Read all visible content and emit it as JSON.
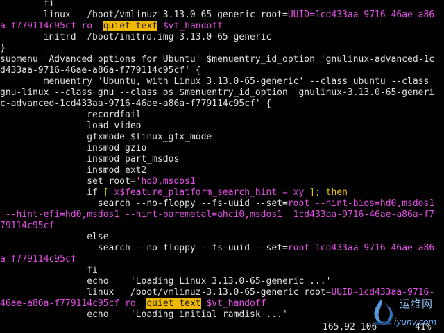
{
  "terminal": {
    "lines": [
      [
        [
          "t",
          "        fi"
        ]
      ],
      [
        [
          "t",
          "        linux   /boot/vmlinuz-3.13.0-65-generic root="
        ],
        [
          "p",
          "UUID=1cd433aa-9716-46ae-a86"
        ]
      ],
      [
        [
          "p",
          "a-f779114c95cf ro  "
        ],
        [
          "h",
          "quiet text"
        ],
        [
          "t",
          " "
        ],
        [
          "p",
          "$vt_handoff"
        ]
      ],
      [
        [
          "t",
          "        initrd  /boot/initrd.img-3.13.0-65-generic"
        ]
      ],
      [
        [
          "t",
          "}"
        ]
      ],
      [
        [
          "t",
          "submenu 'Advanced options for Ubuntu' $menuentry_id_option 'gnulinux-advanced-1c"
        ]
      ],
      [
        [
          "t",
          "d433aa-9716-46ae-a86a-f779114c95cf' {"
        ]
      ],
      [
        [
          "t",
          "        menuentry 'Ubuntu, with Linux 3.13.0-65-generic' --class ubuntu --class"
        ]
      ],
      [
        [
          "t",
          "gnu-linux --class gnu --class os $menuentry_id_option 'gnulinux-3.13.0-65-generi"
        ]
      ],
      [
        [
          "t",
          "c-advanced-1cd433aa-9716-46ae-a86a-f779114c95cf' {"
        ]
      ],
      [
        [
          "t",
          "                recordfail"
        ]
      ],
      [
        [
          "t",
          "                load_video"
        ]
      ],
      [
        [
          "t",
          "                gfxmode $linux_gfx_mode"
        ]
      ],
      [
        [
          "t",
          "                insmod gzio"
        ]
      ],
      [
        [
          "t",
          "                insmod part_msdos"
        ]
      ],
      [
        [
          "t",
          "                insmod ext2"
        ]
      ],
      [
        [
          "t",
          "                set root="
        ],
        [
          "p",
          "'hd0,msdos1'"
        ]
      ],
      [
        [
          "t",
          "                if "
        ],
        [
          "y",
          "[ "
        ],
        [
          "p",
          "x$feature_platform_search_hint = xy"
        ],
        [
          "y",
          " ]; then"
        ]
      ],
      [
        [
          "t",
          "                  search --no-floppy --fs-uuid --set="
        ],
        [
          "p",
          "root --hint-bios=hd0,msdos1"
        ]
      ],
      [
        [
          "p",
          " --hint-efi=hd0,msdos1 --hint-baremetal=ahci0,msdos1  1cd433aa-9716-46ae-a86a-f7"
        ]
      ],
      [
        [
          "p",
          "79114c95cf"
        ]
      ],
      [
        [
          "t",
          "                else"
        ]
      ],
      [
        [
          "t",
          "                  search --no-floppy --fs-uuid --set="
        ],
        [
          "p",
          "root 1cd433aa-9716-46ae-a86"
        ]
      ],
      [
        [
          "p",
          "a-f779114c95cf"
        ]
      ],
      [
        [
          "t",
          "                fi"
        ]
      ],
      [
        [
          "t",
          "                echo    'Loading Linux 3.13.0-65-generic ...'"
        ]
      ],
      [
        [
          "t",
          "                linux   /boot/vmlinuz-3.13.0-65-generic root="
        ],
        [
          "p",
          "UUID=1cd433aa-9716-"
        ]
      ],
      [
        [
          "p",
          "46ae-a86a-f779114c95cf ro  "
        ],
        [
          "h",
          "quiet text"
        ],
        [
          "t",
          " "
        ],
        [
          "p",
          "$vt_handoff"
        ]
      ],
      [
        [
          "t",
          "                echo    'Loading initial ramdisk ...'"
        ]
      ]
    ]
  },
  "status": {
    "position": "165,92-106",
    "percent": "41%"
  },
  "watermark": {
    "brand": "运维网",
    "url": "iyunv.com"
  },
  "colors": {
    "background": "#000000",
    "text": "#e0e0e0",
    "magenta": "#e54fe6",
    "yellow": "#e8c400",
    "search_highlight": "#f0b800"
  }
}
